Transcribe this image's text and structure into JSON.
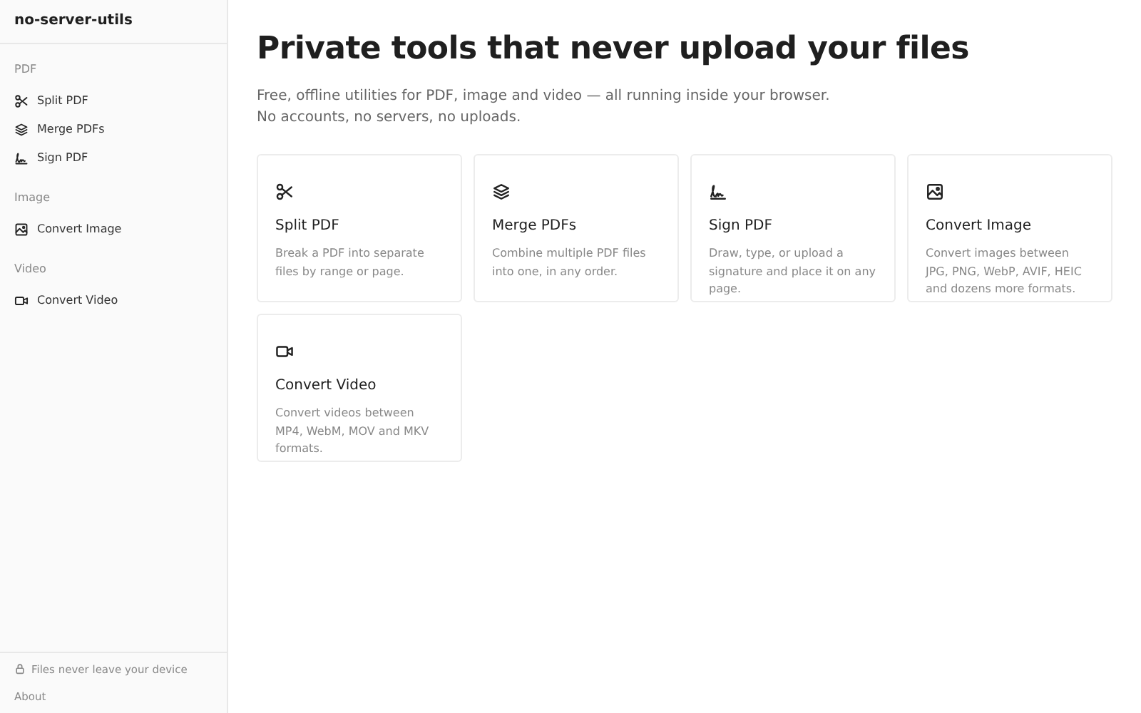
{
  "sidebar": {
    "brand": "no-server-utils",
    "groups": [
      {
        "heading": "PDF",
        "items": [
          {
            "label": "Split PDF",
            "kind": "scissors"
          },
          {
            "label": "Merge PDFs",
            "kind": "layers"
          },
          {
            "label": "Sign PDF",
            "kind": "signature"
          }
        ]
      },
      {
        "heading": "Image",
        "items": [
          {
            "label": "Convert Image",
            "kind": "image"
          }
        ]
      },
      {
        "heading": "Video",
        "items": [
          {
            "label": "Convert Video",
            "kind": "video"
          }
        ]
      }
    ],
    "footer": {
      "note": "Files never leave your device",
      "link": "About"
    }
  },
  "main": {
    "title": "Private tools that never upload your files",
    "intro": [
      "Free, offline utilities for PDF, image and video — all running inside your browser.",
      "No accounts, no servers, no uploads."
    ],
    "tools": [
      {
        "title": "Split PDF",
        "description": "Break a PDF into separate files by range or page.",
        "kind": "scissors"
      },
      {
        "title": "Merge PDFs",
        "description": "Combine multiple PDF files into one, in any order.",
        "kind": "layers"
      },
      {
        "title": "Sign PDF",
        "description": "Draw, type, or upload a signature and place it on any page.",
        "kind": "signature"
      },
      {
        "title": "Convert Image",
        "description": "Convert images between JPG, PNG, WebP, AVIF, HEIC and dozens more formats.",
        "kind": "image"
      },
      {
        "title": "Convert Video",
        "description": "Convert videos between MP4, WebM, MOV and MKV formats.",
        "kind": "video"
      }
    ]
  }
}
